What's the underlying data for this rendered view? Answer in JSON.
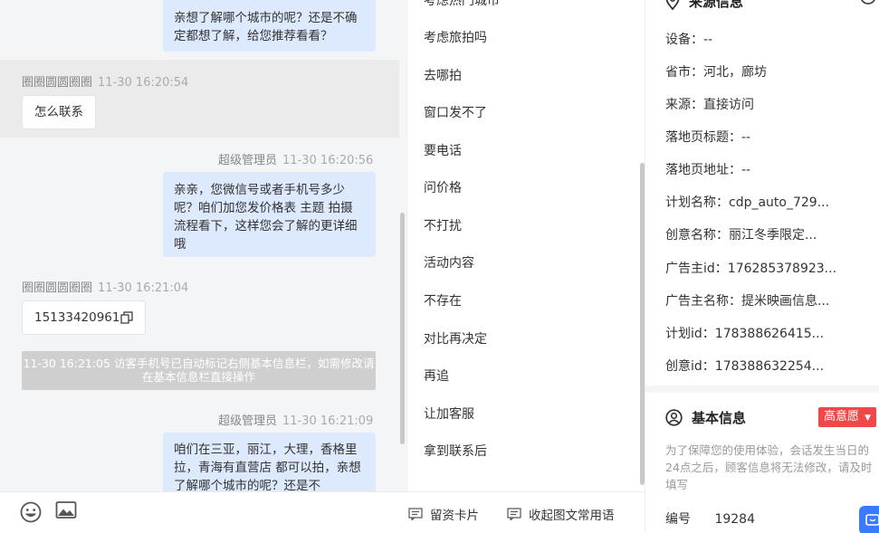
{
  "chat": {
    "messages": [
      {
        "text": "亲想了解哪个城市的呢？还是不确定都想了解，给您推荐看看？"
      },
      {
        "sender": "圈圈圆圆圈圈",
        "time": "11-30 16:20:54",
        "text": "怎么联系"
      },
      {
        "sender": "超级管理员",
        "time": "11-30 16:20:56",
        "text": "亲亲，您微信号或者手机号多少呢？咱们加您发价格表 主题 拍摄流程看下，这样您会了解的更详细哦"
      },
      {
        "sender": "圈圈圆圆圈圈",
        "time": "11-30 16:21:04",
        "text": "15133420961"
      },
      {
        "system": "11-30 16:21:05 访客手机号已自动标记右侧基本信息栏，如需修改请在基本信息栏直接操作"
      },
      {
        "sender": "超级管理员",
        "time": "11-30 16:21:09",
        "text": "咱们在三亚，丽江，大理，香格里拉，青海有直营店 都可以拍，亲想了解哪个城市的呢？还是不"
      }
    ],
    "toolbar": {
      "emoji_icon": "smile-icon",
      "image_icon": "image-icon",
      "card_label": "留资卡片",
      "phrases_label": "收起图文常用语"
    }
  },
  "quick_replies": {
    "items": [
      "考虑热门城市",
      "考虑旅拍吗",
      "去哪拍",
      "窗口发不了",
      "要电话",
      "问价格",
      "不打扰",
      "活动内容",
      "不存在",
      "对比再决定",
      "再追",
      "让加客服",
      "拿到联系后"
    ]
  },
  "info": {
    "source_title": "来源信息",
    "source_rows": [
      {
        "label": "设备：",
        "value": "--"
      },
      {
        "label": "省市：",
        "value": "河北，廊坊"
      },
      {
        "label": "来源：",
        "value": "直接访问"
      },
      {
        "label": "落地页标题：",
        "value": "--"
      },
      {
        "label": "落地页地址：",
        "value": "--"
      },
      {
        "label": "计划名称：",
        "value": "cdp_auto_729..."
      },
      {
        "label": "创意名称：",
        "value": "丽江冬季限定..."
      },
      {
        "label": "广告主id：",
        "value": "176285378923..."
      },
      {
        "label": "广告主名称：",
        "value": "提米映画信息..."
      },
      {
        "label": "计划id：",
        "value": "178388626415..."
      },
      {
        "label": "创意id：",
        "value": "178388632254..."
      }
    ],
    "basic_title": "基本信息",
    "intent_badge": "高意愿",
    "tip": "为了保障您的使用体验，会话发生当日的24点之后，顾客信息将无法修改，请及时填写",
    "id_label": "编号",
    "id_value": "19284",
    "accent": "#3a7afe",
    "badge_color": "#f04848"
  }
}
